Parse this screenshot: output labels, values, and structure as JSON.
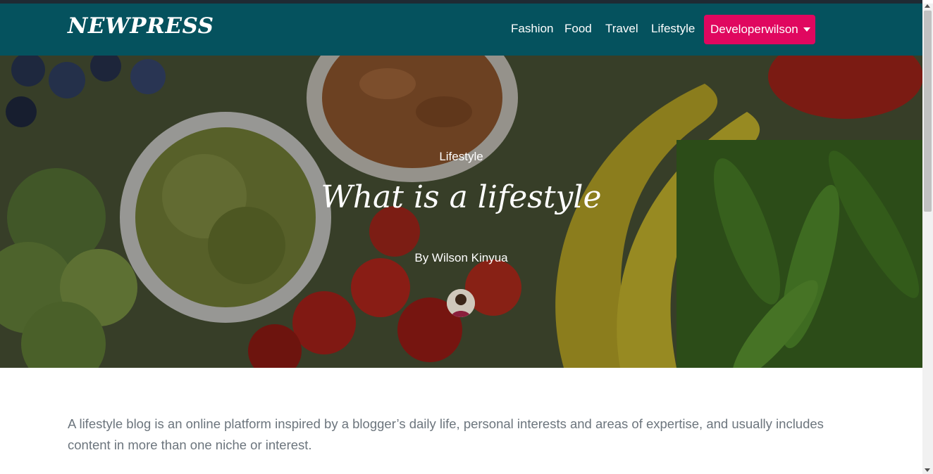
{
  "navbar": {
    "brand": "NEWPRESS",
    "links": [
      "Fashion",
      "Food",
      "Travel",
      "Lifestyle"
    ],
    "user_menu_label": "Developerwilson",
    "background_color": "#05525e",
    "user_button_color": "#e0075f"
  },
  "hero": {
    "category": "Lifestyle",
    "title": "What is a lifestyle",
    "author": "By Wilson Kinyua"
  },
  "article": {
    "paragraphs": [
      "A lifestyle blog is an online platform inspired by a blogger’s daily life, personal interests and areas of expertise, and usually includes content in more than one niche or interest."
    ]
  }
}
